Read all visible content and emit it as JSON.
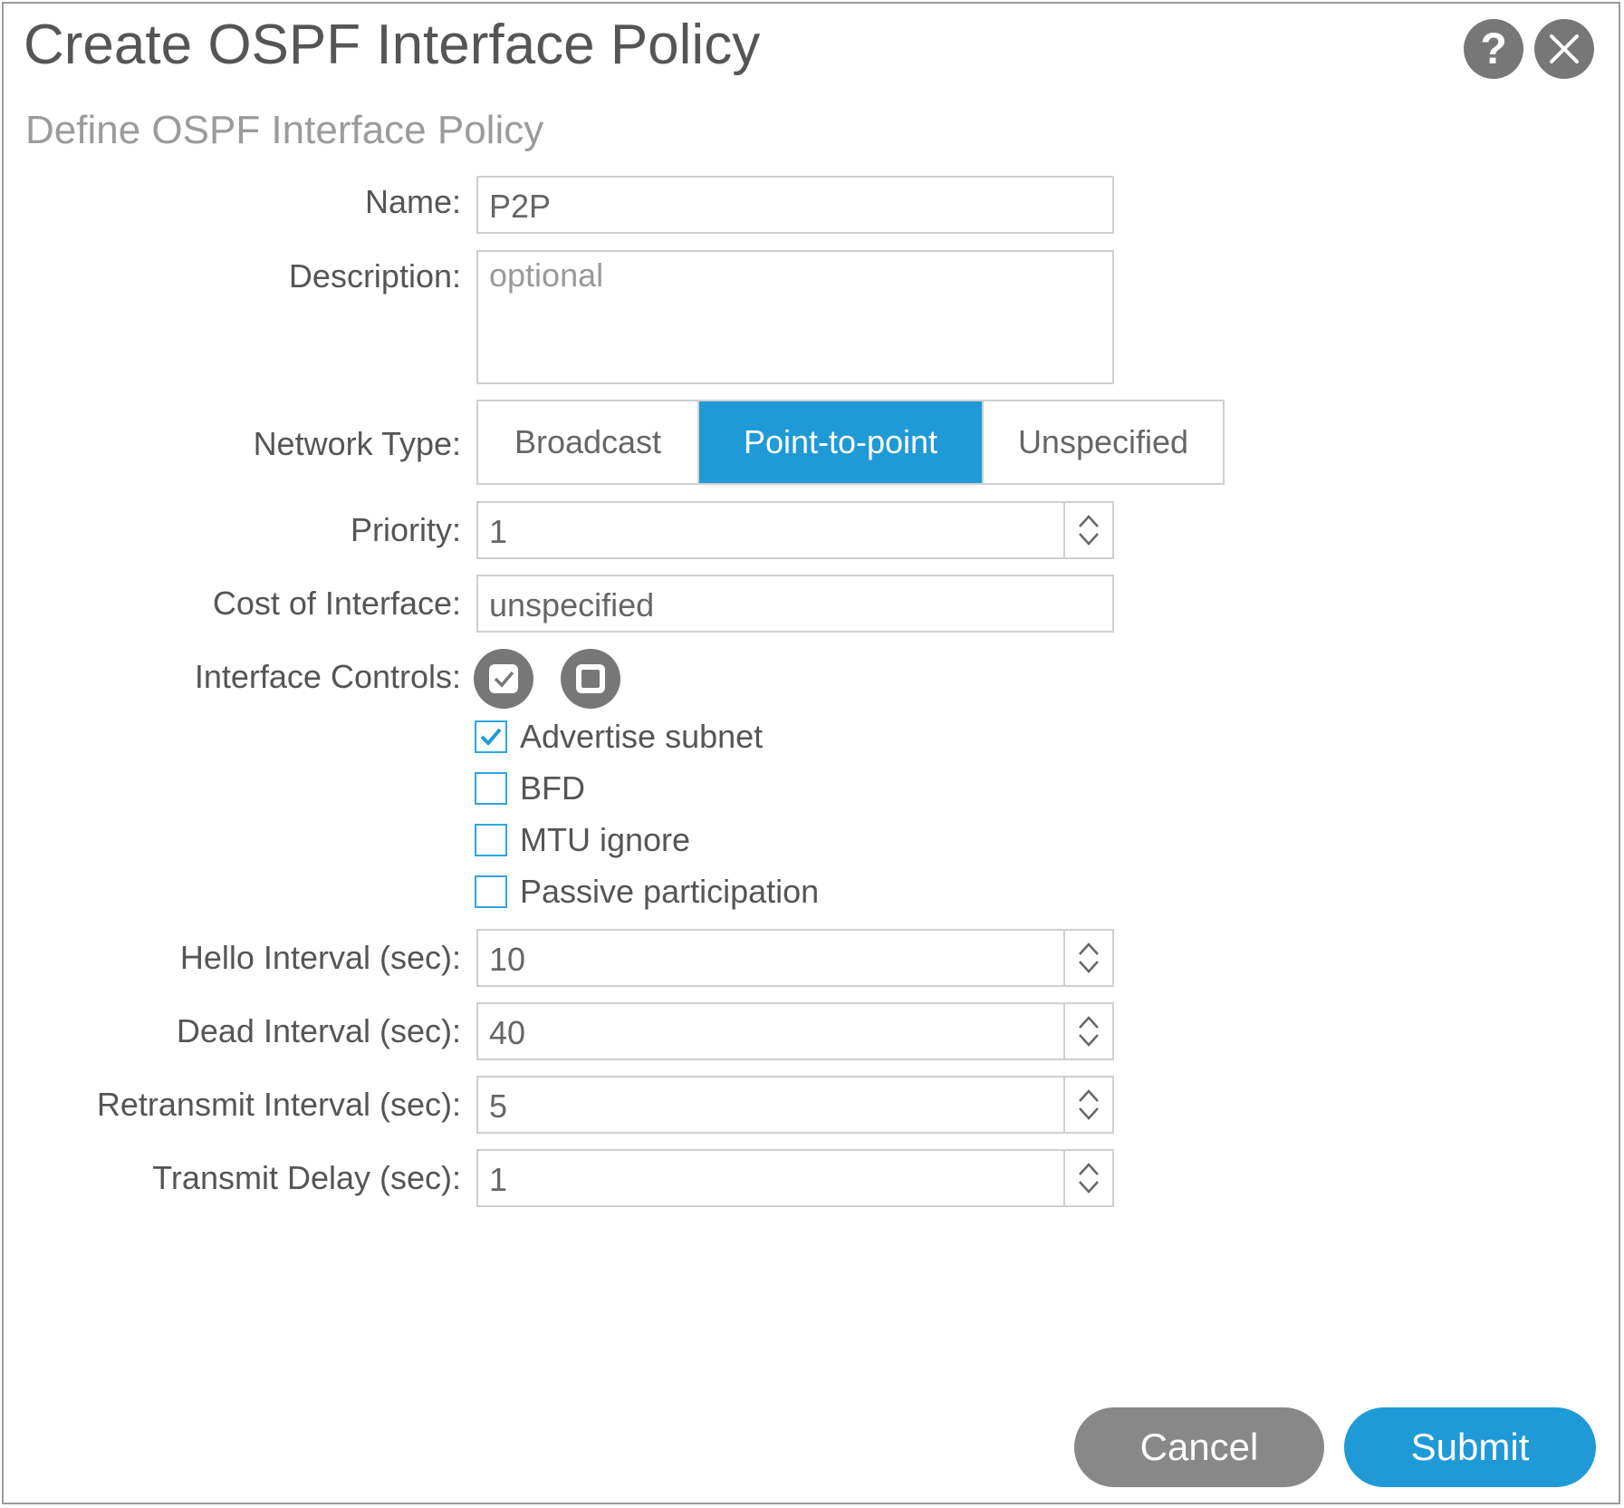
{
  "dialog": {
    "title": "Create OSPF Interface Policy",
    "subtitle": "Define OSPF Interface Policy",
    "help_icon": "question-icon",
    "close_icon": "close-icon"
  },
  "form": {
    "name": {
      "label": "Name:",
      "value": "P2P"
    },
    "description": {
      "label": "Description:",
      "placeholder": "optional",
      "value": ""
    },
    "network_type": {
      "label": "Network Type:",
      "options": [
        "Broadcast",
        "Point-to-point",
        "Unspecified"
      ],
      "selected": "Point-to-point"
    },
    "priority": {
      "label": "Priority:",
      "value": "1"
    },
    "cost": {
      "label": "Cost of Interface:",
      "value": "unspecified"
    },
    "interface_controls": {
      "label": "Interface Controls:",
      "icons": [
        "select-all-icon",
        "deselect-all-icon"
      ],
      "options": [
        {
          "label": "Advertise subnet",
          "checked": true
        },
        {
          "label": "BFD",
          "checked": false
        },
        {
          "label": "MTU ignore",
          "checked": false
        },
        {
          "label": "Passive participation",
          "checked": false
        }
      ]
    },
    "hello_interval": {
      "label": "Hello Interval (sec):",
      "value": "10"
    },
    "dead_interval": {
      "label": "Dead Interval (sec):",
      "value": "40"
    },
    "retransmit_interval": {
      "label": "Retransmit Interval (sec):",
      "value": "5"
    },
    "transmit_delay": {
      "label": "Transmit Delay (sec):",
      "value": "1"
    }
  },
  "buttons": {
    "cancel": "Cancel",
    "submit": "Submit"
  },
  "colors": {
    "accent": "#1f9ad6",
    "icon_gray": "#777777",
    "cancel_gray": "#888888"
  }
}
